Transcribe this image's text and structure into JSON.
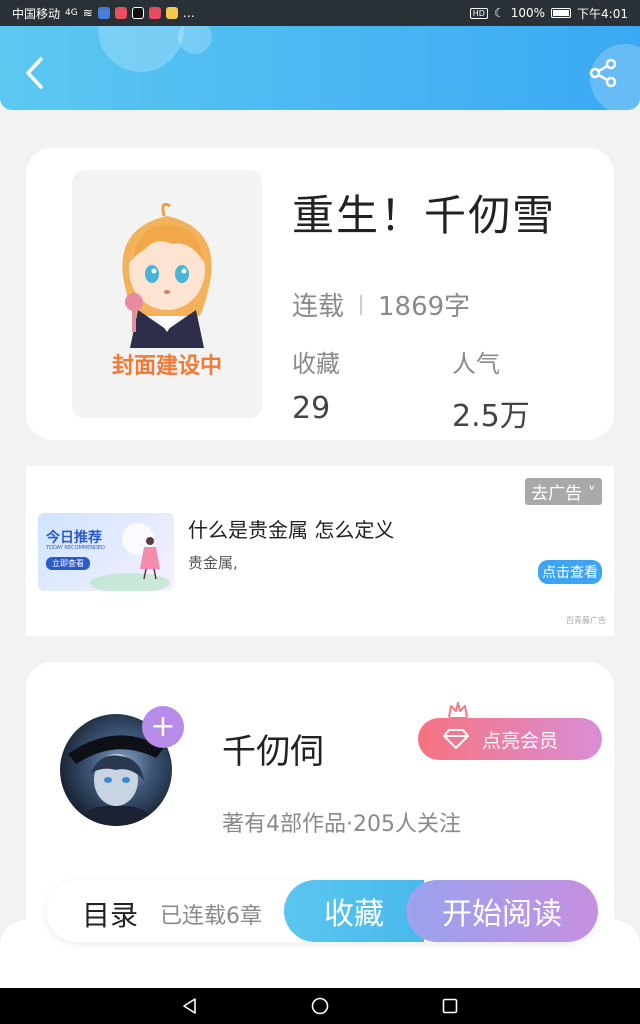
{
  "status_bar": {
    "carrier": "中国移动",
    "signal_text": "4G",
    "more": "…",
    "battery": "100%",
    "time": "下午4:01",
    "hd": "HD"
  },
  "header": {
    "back_icon": "chevron-left-icon",
    "share_icon": "share-icon"
  },
  "book": {
    "title": "重生！千仞雪",
    "status": "连载",
    "word_count": "1869字",
    "cover_caption": "封面建设中",
    "favorites_label": "收藏",
    "favorites_value": "29",
    "popularity_label": "人气",
    "popularity_value": "2.5万"
  },
  "ad": {
    "close_label": "去广告",
    "image_title": "今日推荐",
    "image_sub": "TODAY RECOMMENDED",
    "image_button": "立即查看",
    "title": "什么是贵金属 怎么定义",
    "description": "贵金属,",
    "cta": "点击查看",
    "source": "百青藤广告"
  },
  "author": {
    "name": "千仞伺",
    "follow_symbol": "+",
    "vip_label": "点亮会员",
    "stats": "著有4部作品·205人关注"
  },
  "action_bar": {
    "toc_label": "目录",
    "chapters_label": "已连载6章",
    "collect_label": "收藏",
    "read_label": "开始阅读"
  },
  "colors": {
    "header": "#3aa9f3",
    "cover_caption": "#f27a34",
    "collect": "#48b9ec",
    "read_gradient_end": "#c690e0",
    "vip_gradient_start": "#f6737f"
  }
}
